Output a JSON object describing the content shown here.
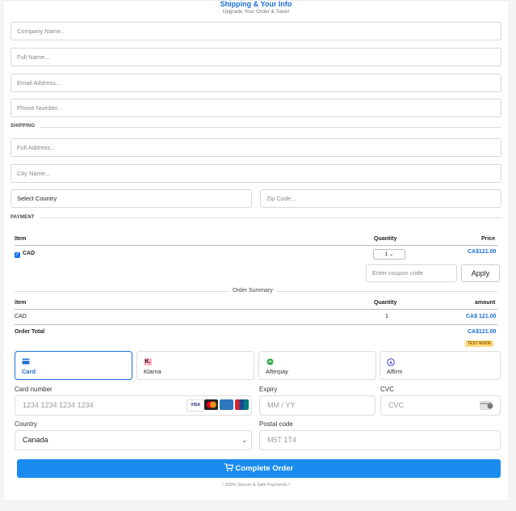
{
  "header": {
    "title": "Shipping & Your Info",
    "subtitle": "Upgrade Your Order & Save!"
  },
  "info": {
    "company_placeholder": "Company Name..",
    "fullname_placeholder": "Full Name...",
    "email_placeholder": "Email Address...",
    "phone_placeholder": "Phone Number..."
  },
  "shipping": {
    "section_label": "SHIPPING",
    "address_placeholder": "Full Address...",
    "city_placeholder": "City Name...",
    "country_value": "Select Country",
    "zip_placeholder": "Zip Code..."
  },
  "payment": {
    "section_label": "PAYMENT",
    "col_item": "Item",
    "col_quantity": "Quantity",
    "col_price": "Price",
    "product_name": "CAD",
    "product_qty": "1",
    "product_price": "CA$121.00",
    "coupon_placeholder": "Enter coupon code",
    "apply_label": "Apply"
  },
  "summary": {
    "label": "Order Summary",
    "col_item": "item",
    "col_quantity": "Quantity",
    "col_amount": "amount",
    "row_item": "CAD",
    "row_qty": "1",
    "row_amount": "CA$ 121.00",
    "total_label": "Order Total",
    "total_value": "CA$121.00",
    "mode_badge": "TEST MODE"
  },
  "methods": [
    {
      "label": "Card",
      "icon": "card-icon",
      "color": "#1a6fd6"
    },
    {
      "label": "Klarna",
      "icon": "klarna-icon",
      "color": "#ffb3c7"
    },
    {
      "label": "Afterpay",
      "icon": "afterpay-icon",
      "color": "#2aa84a"
    },
    {
      "label": "Affirm",
      "icon": "affirm-icon",
      "color": "#3b3fb8"
    }
  ],
  "card_form": {
    "number_label": "Card number",
    "number_placeholder": "1234 1234 1234 1234",
    "expiry_label": "Expiry",
    "expiry_placeholder": "MM / YY",
    "cvc_label": "CVC",
    "cvc_placeholder": "CVC",
    "country_label": "Country",
    "country_value": "Canada",
    "postal_label": "Postal code",
    "postal_placeholder": "M5T 1T4",
    "brand_visa": "VISA"
  },
  "submit": {
    "label": "Complete Order",
    "secure_note": "* 100% Secure & Safe Payments *"
  },
  "colors": {
    "accent": "#1a6fd6",
    "button": "#1a8cf0"
  }
}
